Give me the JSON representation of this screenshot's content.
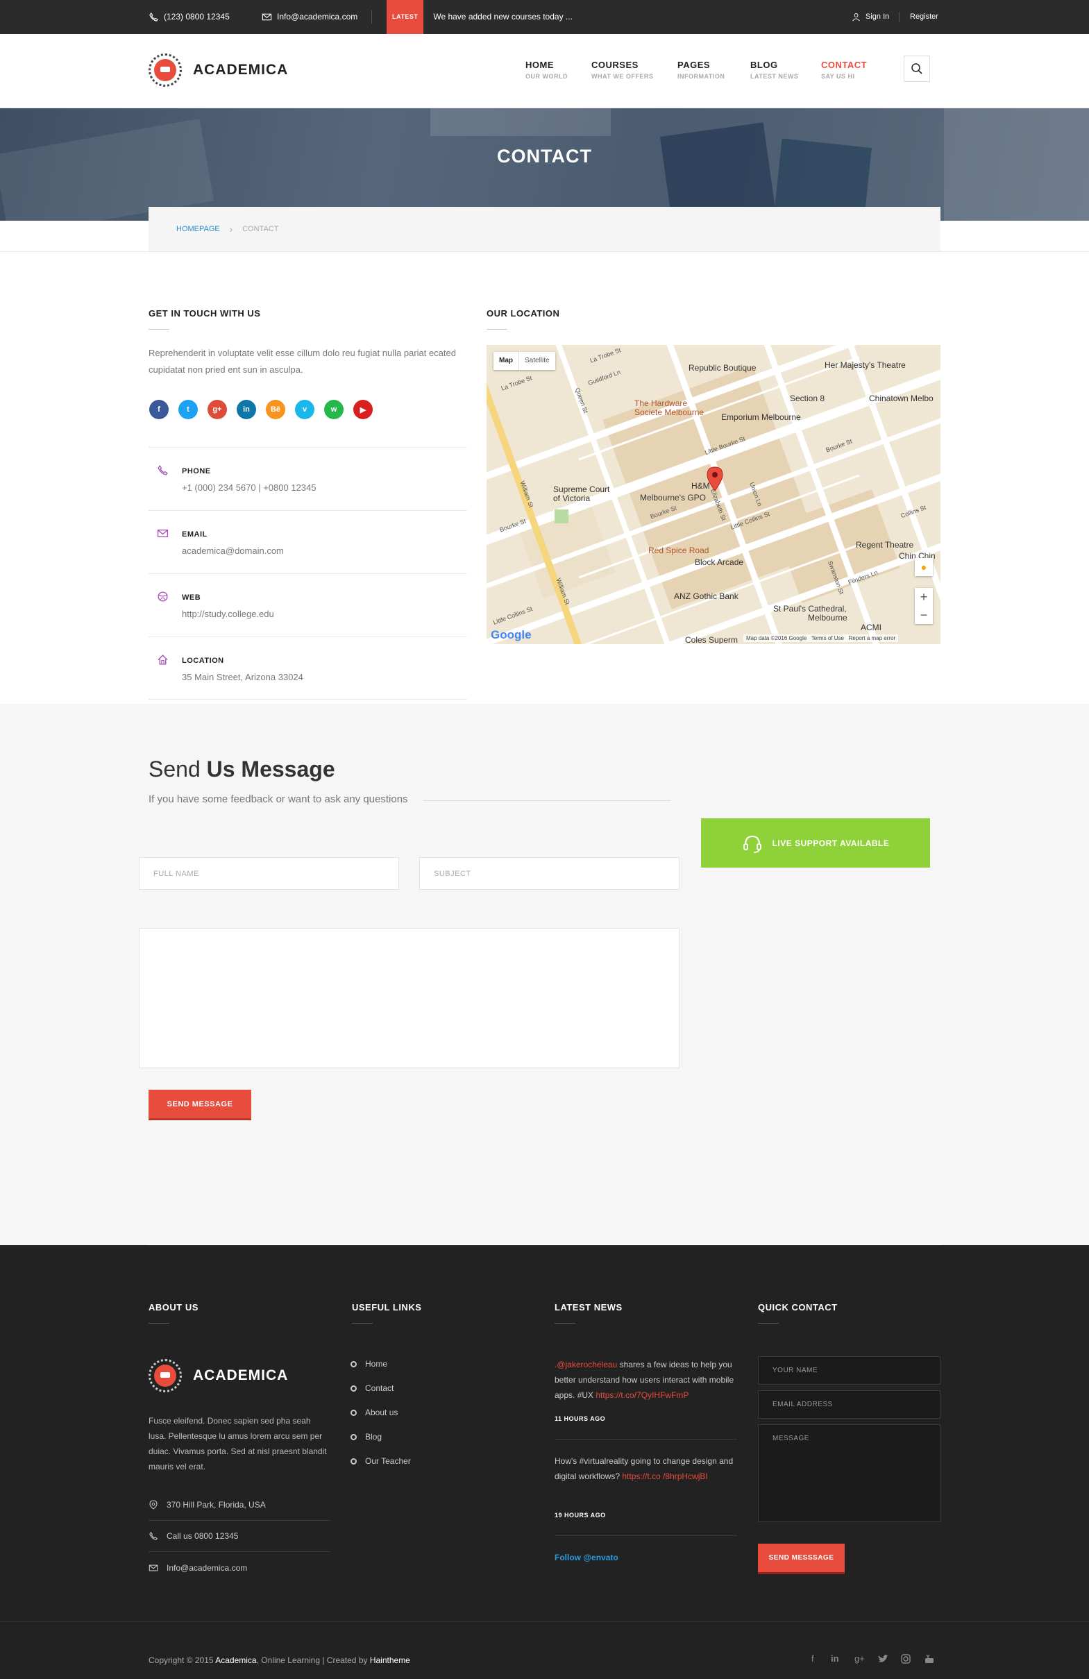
{
  "topbar": {
    "phone": "(123) 0800 12345",
    "email": "Info@academica.com",
    "latest_badge": "LATEST",
    "latest_text": "We have added new courses today ...",
    "signin": "Sign In",
    "register": "Register"
  },
  "header": {
    "logo_text": "ACADEMICA",
    "nav": [
      {
        "label": "HOME",
        "sub": "OUR WORLD"
      },
      {
        "label": "COURSES",
        "sub": "WHAT WE OFFERS"
      },
      {
        "label": "PAGES",
        "sub": "INFORMATION"
      },
      {
        "label": "BLOG",
        "sub": "LATEST NEWS"
      },
      {
        "label": "CONTACT",
        "sub": "SAY US HI"
      }
    ]
  },
  "hero": {
    "title": "CONTACT"
  },
  "breadcrumb": {
    "home": "HOMEPAGE",
    "current": "CONTACT"
  },
  "contact": {
    "title": "GET IN TOUCH WITH US",
    "text": "Reprehenderit in voluptate velit esse cillum dolo reu fugiat nulla pariat ecated cupidatat non pried ent sun in asculpa.",
    "socials": [
      {
        "icon": "facebook-icon",
        "glyph": "f",
        "color": "#3b5998"
      },
      {
        "icon": "twitter-icon",
        "glyph": "t",
        "color": "#1da1f2"
      },
      {
        "icon": "google-plus-icon",
        "glyph": "g+",
        "color": "#dd4b39"
      },
      {
        "icon": "linkedin-icon",
        "glyph": "in",
        "color": "#0e76a8"
      },
      {
        "icon": "behance-icon",
        "glyph": "Bē",
        "color": "#f7931e"
      },
      {
        "icon": "vimeo-icon",
        "glyph": "v",
        "color": "#1ab7ea"
      },
      {
        "icon": "whatsapp-icon",
        "glyph": "w",
        "color": "#25b84a"
      },
      {
        "icon": "youtube-icon",
        "glyph": "▶",
        "color": "#d8201e"
      }
    ],
    "rows": [
      {
        "label": "PHONE",
        "value": "+1 (000) 234 5670 | +0800 12345"
      },
      {
        "label": "EMAIL",
        "value": "academica@domain.com"
      },
      {
        "label": "WEB",
        "value": "http://study.college.edu"
      },
      {
        "label": "LOCATION",
        "value": "35 Main Street, Arizona 33024"
      }
    ]
  },
  "location": {
    "title": "OUR LOCATION",
    "map_tab_map": "Map",
    "map_tab_satellite": "Satellite",
    "labels": {
      "l1": "Republic Boutique",
      "l2": "Her Majesty's Theatre",
      "l3": "The Hardware",
      "l3b": "Societe Melbourne",
      "l4": "Emporium Melbourne",
      "l5": "Section 8",
      "l6": "Chinatown Melbo",
      "l7": "Supreme Court",
      "l7b": "of Victoria",
      "l8": "H&M",
      "l9": "Melbourne's GPO",
      "l10": "Red Spice Road",
      "l11": "Block Arcade",
      "l12": "ANZ Gothic Bank",
      "l13": "Regent Theatre",
      "l14": "St Paul's Cathedral,",
      "l14b": "Melbourne",
      "l15": "Coles Superm",
      "l16": "Chin Chin",
      "l17": "ACMI",
      "s1": "La Trobe St",
      "s2": "William St",
      "s3": "Little Bourke St",
      "s4": "Bourke St",
      "s5": "Elizabeth St",
      "s6": "Little Collins St",
      "s7": "Swanston St",
      "s8": "Flinders Ln",
      "s9": "Collins St",
      "s10": "Queen St",
      "s11": "Guildford Ln",
      "s12": "Union Ln",
      "google": "Google",
      "footer": "Map data ©2016 Google   Terms of Use   Report a map error"
    }
  },
  "message": {
    "title_light": "Send",
    "title_bold": "Us Message",
    "subtitle": "If you have some feedback or want to ask any questions",
    "support": "LIVE SUPPORT AVAILABLE",
    "full_name": "FULL NAME",
    "subject": "SUBJECT",
    "send": "SEND MESSAGE"
  },
  "footer": {
    "about_title": "ABOUT US",
    "logo_text": "ACADEMICA",
    "about_text": "Fusce eleifend. Donec sapien sed pha seah lusa. Pellentesque lu amus lorem arcu sem per duiac. Vivamus porta. Sed at nisl praesnt blandit mauris vel erat.",
    "address": "370 Hill Park, Florida, USA",
    "phone": "Call us 0800 12345",
    "email": "Info@academica.com",
    "links_title": "USEFUL LINKS",
    "links": [
      "Home",
      "Contact",
      "About us",
      "Blog",
      "Our Teacher"
    ],
    "news_title": "LATEST NEWS",
    "news1_handle": ".@jakerocheleau",
    "news1_text": " shares a few ideas to help you better understand how users interact with mobile apps. #UX ",
    "news1_link": "https://t.co/7QyIHFwFmP",
    "news1_time": "11 HOURS AGO",
    "news2_text": "How's #virtualreality going to change design and digital workflows? ",
    "news2_link": "https://t.co /8hrpHcwjBI",
    "news2_time": "19 HOURS AGO",
    "follow": "Follow @envato",
    "quick_title": "QUICK CONTACT",
    "your_name": "YOUR NAME",
    "email_address": "EMAIL ADDRESS",
    "message": "MESSAGE",
    "send": "SEND MESSSAGE",
    "copy_1": "Copyright © 2015 ",
    "copy_brand": "Academica",
    "copy_2": ", Online Learning | Created by ",
    "copy_author": "Haintheme"
  }
}
